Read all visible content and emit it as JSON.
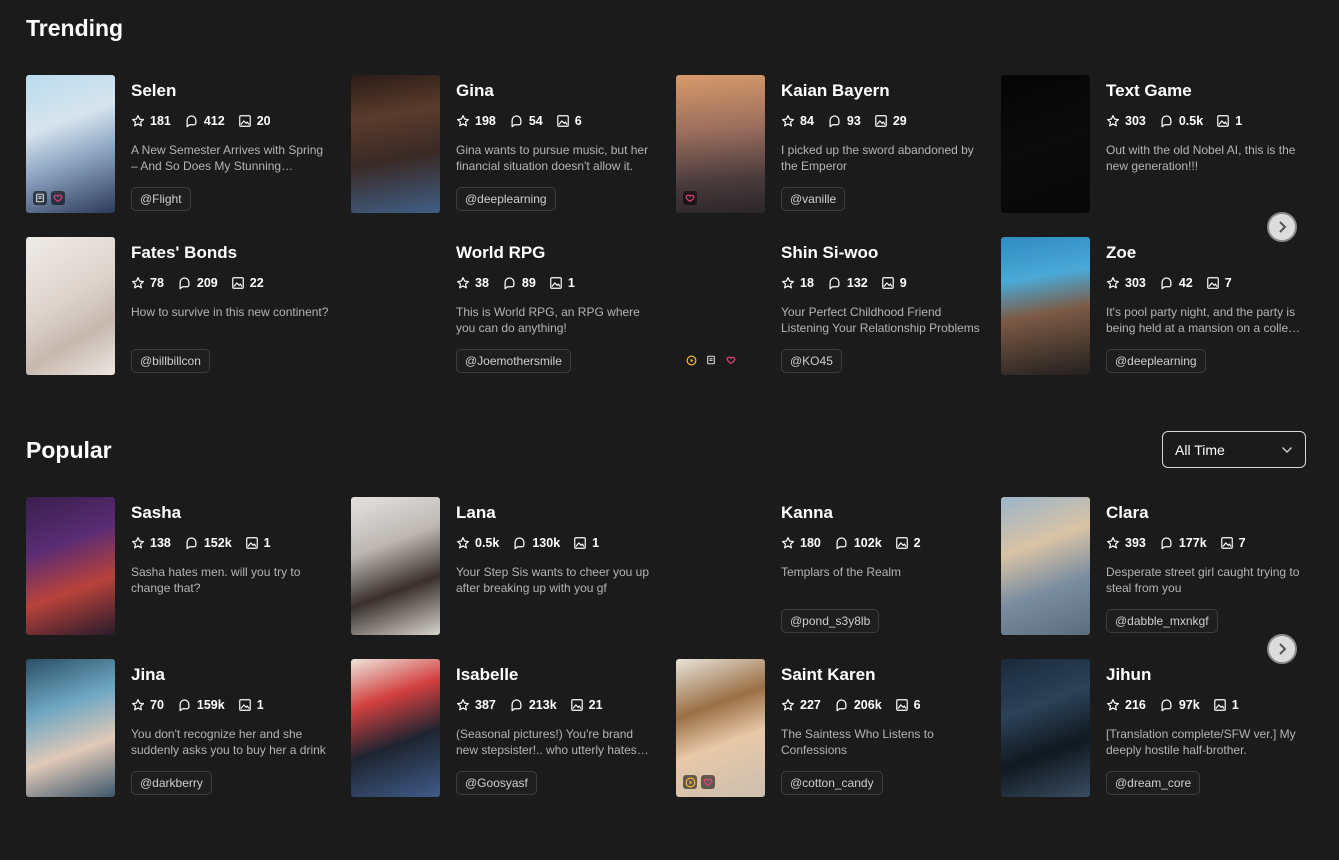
{
  "sections": {
    "trending": {
      "title": "Trending"
    },
    "popular": {
      "title": "Popular",
      "sort_value": "All Time"
    }
  },
  "trending_cards": [
    {
      "name": "Selen",
      "likes": "181",
      "chats": "412",
      "images": "20",
      "desc": "A New Semester Arrives with Spring – And So Does My Stunning Roommate",
      "author": "@Flight"
    },
    {
      "name": "Gina",
      "likes": "198",
      "chats": "54",
      "images": "6",
      "desc": "Gina wants to pursue music, but her financial situation doesn't allow it.",
      "author": "@deeplearning"
    },
    {
      "name": "Kaian Bayern",
      "likes": "84",
      "chats": "93",
      "images": "29",
      "desc": "I picked up the sword abandoned by the Emperor",
      "author": "@vanille"
    },
    {
      "name": "Text Game",
      "likes": "303",
      "chats": "0.5k",
      "images": "1",
      "desc": "Out with the old Nobel AI, this is the new generation!!!",
      "author": ""
    },
    {
      "name": "Fates' Bonds",
      "likes": "78",
      "chats": "209",
      "images": "22",
      "desc": "How to survive in this new continent?",
      "author": "@billbillcon"
    },
    {
      "name": "World RPG",
      "likes": "38",
      "chats": "89",
      "images": "1",
      "desc": "This is World RPG, an RPG where you can do anything!",
      "author": "@Joemothersmile"
    },
    {
      "name": "Shin Si-woo",
      "likes": "18",
      "chats": "132",
      "images": "9",
      "desc": "Your Perfect Childhood Friend Listening Your Relationship Problems",
      "author": "@KO45"
    },
    {
      "name": "Zoe",
      "likes": "303",
      "chats": "42",
      "images": "7",
      "desc": "It's pool party night, and the party is being held at a mansion on a college campus",
      "author": "@deeplearning"
    }
  ],
  "popular_cards": [
    {
      "name": "Sasha",
      "likes": "138",
      "chats": "152k",
      "images": "1",
      "desc": "Sasha hates men. will you try to change that?",
      "author": ""
    },
    {
      "name": "Lana",
      "likes": "0.5k",
      "chats": "130k",
      "images": "1",
      "desc": "Your Step Sis wants to cheer you up after breaking up with you gf",
      "author": ""
    },
    {
      "name": "Kanna",
      "likes": "180",
      "chats": "102k",
      "images": "2",
      "desc": "Templars of the Realm",
      "author": "@pond_s3y8lb"
    },
    {
      "name": "Clara",
      "likes": "393",
      "chats": "177k",
      "images": "7",
      "desc": "Desperate street girl caught trying to steal from you",
      "author": "@dabble_mxnkgf"
    },
    {
      "name": "Jina",
      "likes": "70",
      "chats": "159k",
      "images": "1",
      "desc": "You don't recognize her and she suddenly asks you to buy her a drink",
      "author": "@darkberry"
    },
    {
      "name": "Isabelle",
      "likes": "387",
      "chats": "213k",
      "images": "21",
      "desc": "(Seasonal pictures!) You're brand new stepsister!.. who utterly hates you",
      "author": "@Goosyasf"
    },
    {
      "name": "Saint Karen",
      "likes": "227",
      "chats": "206k",
      "images": "6",
      "desc": "The Saintess Who Listens to Confessions",
      "author": "@cotton_candy"
    },
    {
      "name": "Jihun",
      "likes": "216",
      "chats": "97k",
      "images": "1",
      "desc": "[Translation complete/SFW ver.] My deeply hostile half-brother.",
      "author": "@dream_core"
    }
  ],
  "colors": {
    "background": "#1b1b1b",
    "heart": "#e0457b",
    "play": "#f5b82e"
  }
}
